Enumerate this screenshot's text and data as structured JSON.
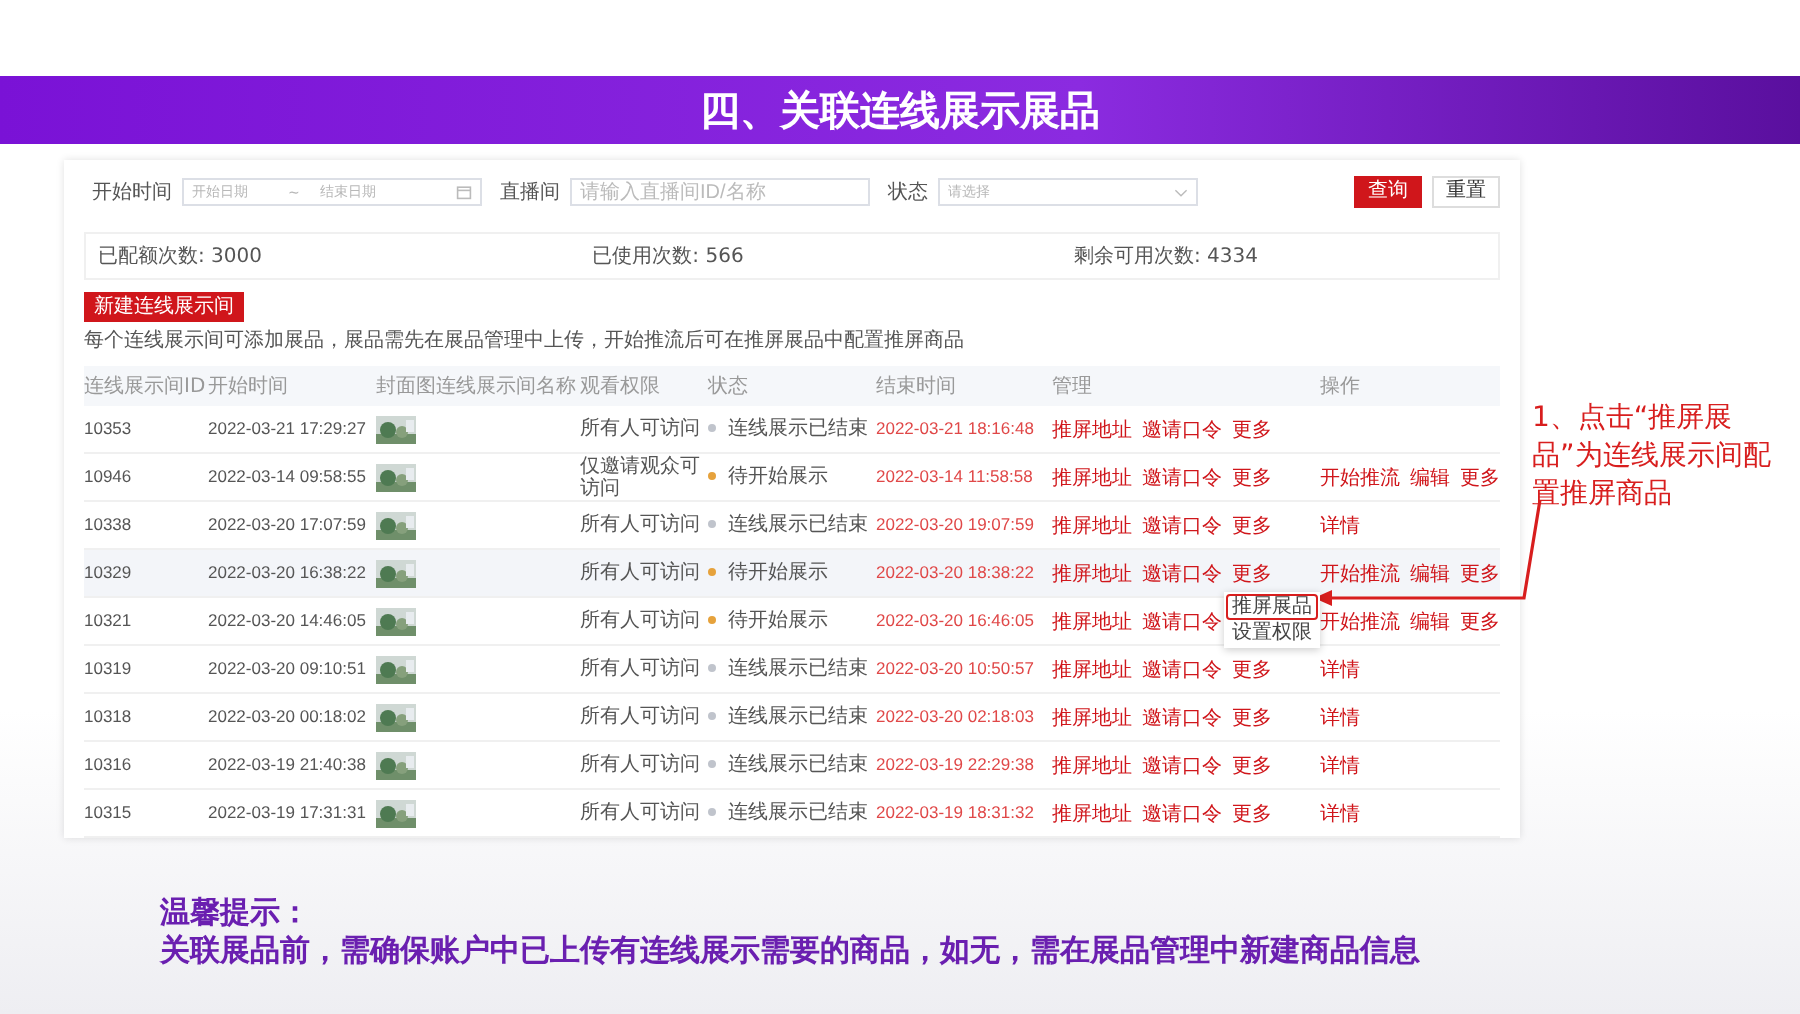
{
  "slide_title": "四、关联连线展示展品",
  "filters": [
    {
      "label": "开始时间",
      "kind": "daterange",
      "placeholder": "开始日期",
      "separator": "~",
      "placeholder_end": "结束日期"
    },
    {
      "label": "直播间",
      "kind": "text",
      "placeholder": "请输入直播间ID/名称"
    },
    {
      "label": "状态",
      "kind": "select",
      "placeholder": "请选择"
    }
  ],
  "buttons": [
    {
      "label": "查询",
      "primary": true
    },
    {
      "label": "重置",
      "primary": false
    }
  ],
  "stats": [
    "已配额次数: 3000",
    "已使用次数: 566",
    "剩余可用次数: 4334"
  ],
  "create_button": "新建连线展示间",
  "note": "每个连线展示间可添加展品，展品需先在展品管理中上传，开始推流后可在推屏展品中配置推屏商品",
  "table": {
    "columns": [
      "连线展示间ID",
      "开始时间",
      "封面图",
      "连线展示间名称",
      "观看权限",
      "状态",
      "结束时间",
      "管理",
      "操作"
    ],
    "rows": [
      {
        "id": "10353",
        "start": "2022-03-21 17:29:27",
        "cover": {
          "kind": "picture"
        },
        "permission": "所有人可访问",
        "status": "连线展示已结束",
        "color": "#c0c4cc",
        "end": "2022-03-21 18:16:48",
        "manage": [
          "推屏地址",
          "邀请口令",
          "更多"
        ],
        "actions": [],
        "highlighted": false
      },
      {
        "id": "10946",
        "start": "2022-03-14 09:58:55",
        "cover": {
          "kind": "picture"
        },
        "permission": "仅邀请观众可访问",
        "status": "待开始展示",
        "color": "#e6a23c",
        "end": "2022-03-14 11:58:58",
        "manage": [
          "推屏地址",
          "邀请口令",
          "更多"
        ],
        "actions": [
          "开始推流",
          "编辑",
          "更多"
        ],
        "highlighted": false
      },
      {
        "id": "10338",
        "start": "2022-03-20 17:07:59",
        "cover": {
          "kind": "picture"
        },
        "permission": "所有人可访问",
        "status": "连线展示已结束",
        "color": "#c0c4cc",
        "end": "2022-03-20 19:07:59",
        "manage": [
          "推屏地址",
          "邀请口令",
          "更多"
        ],
        "actions": [
          "详情"
        ],
        "highlighted": false
      },
      {
        "id": "10329",
        "start": "2022-03-20 16:38:22",
        "cover": {
          "kind": "picture"
        },
        "permission": "所有人可访问",
        "status": "待开始展示",
        "color": "#e6a23c",
        "end": "2022-03-20 18:38:22",
        "manage": [
          "推屏地址",
          "邀请口令",
          "更多"
        ],
        "actions": [
          "开始推流",
          "编辑",
          "更多"
        ],
        "highlighted": true,
        "menu": [
          {
            "label": "推屏展品",
            "marked": true
          },
          {
            "label": "设置权限",
            "marked": false
          }
        ]
      },
      {
        "id": "10321",
        "start": "2022-03-20 14:46:05",
        "cover": {
          "kind": "picture"
        },
        "permission": "所有人可访问",
        "status": "待开始展示",
        "color": "#e6a23c",
        "end": "2022-03-20 16:46:05",
        "manage": [
          "推屏地址",
          "邀请口令"
        ],
        "actions": [
          "开始推流",
          "编辑",
          "更多"
        ],
        "highlighted": false
      },
      {
        "id": "10319",
        "start": "2022-03-20 09:10:51",
        "cover": {
          "kind": "picture"
        },
        "permission": "所有人可访问",
        "status": "连线展示已结束",
        "color": "#c0c4cc",
        "end": "2022-03-20 10:50:57",
        "manage": [
          "推屏地址",
          "邀请口令",
          "更多"
        ],
        "actions": [
          "详情"
        ],
        "highlighted": false
      },
      {
        "id": "10318",
        "start": "2022-03-20 00:18:02",
        "cover": {
          "kind": "picture"
        },
        "permission": "所有人可访问",
        "status": "连线展示已结束",
        "color": "#c0c4cc",
        "end": "2022-03-20 02:18:03",
        "manage": [
          "推屏地址",
          "邀请口令",
          "更多"
        ],
        "actions": [
          "详情"
        ],
        "highlighted": false
      },
      {
        "id": "10316",
        "start": "2022-03-19 21:40:38",
        "cover": {
          "kind": "picture"
        },
        "permission": "所有人可访问",
        "status": "连线展示已结束",
        "color": "#c0c4cc",
        "end": "2022-03-19 22:29:38",
        "manage": [
          "推屏地址",
          "邀请口令",
          "更多"
        ],
        "actions": [
          "详情"
        ],
        "highlighted": false
      },
      {
        "id": "10315",
        "start": "2022-03-19 17:31:31",
        "cover": {
          "kind": "picture"
        },
        "permission": "所有人可访问",
        "status": "连线展示已结束",
        "color": "#c0c4cc",
        "end": "2022-03-19 18:31:32",
        "manage": [
          "推屏地址",
          "邀请口令",
          "更多"
        ],
        "actions": [
          "详情"
        ],
        "highlighted": false
      }
    ]
  },
  "annotation": "1、点击“推屏展品”为连线展示间配置推屏商品",
  "tip": {
    "title": "温馨提示：",
    "text": "关联展品前，需确保账户中已上传有连线展示需要的商品，如无，需在展品管理中新建商品信息"
  }
}
